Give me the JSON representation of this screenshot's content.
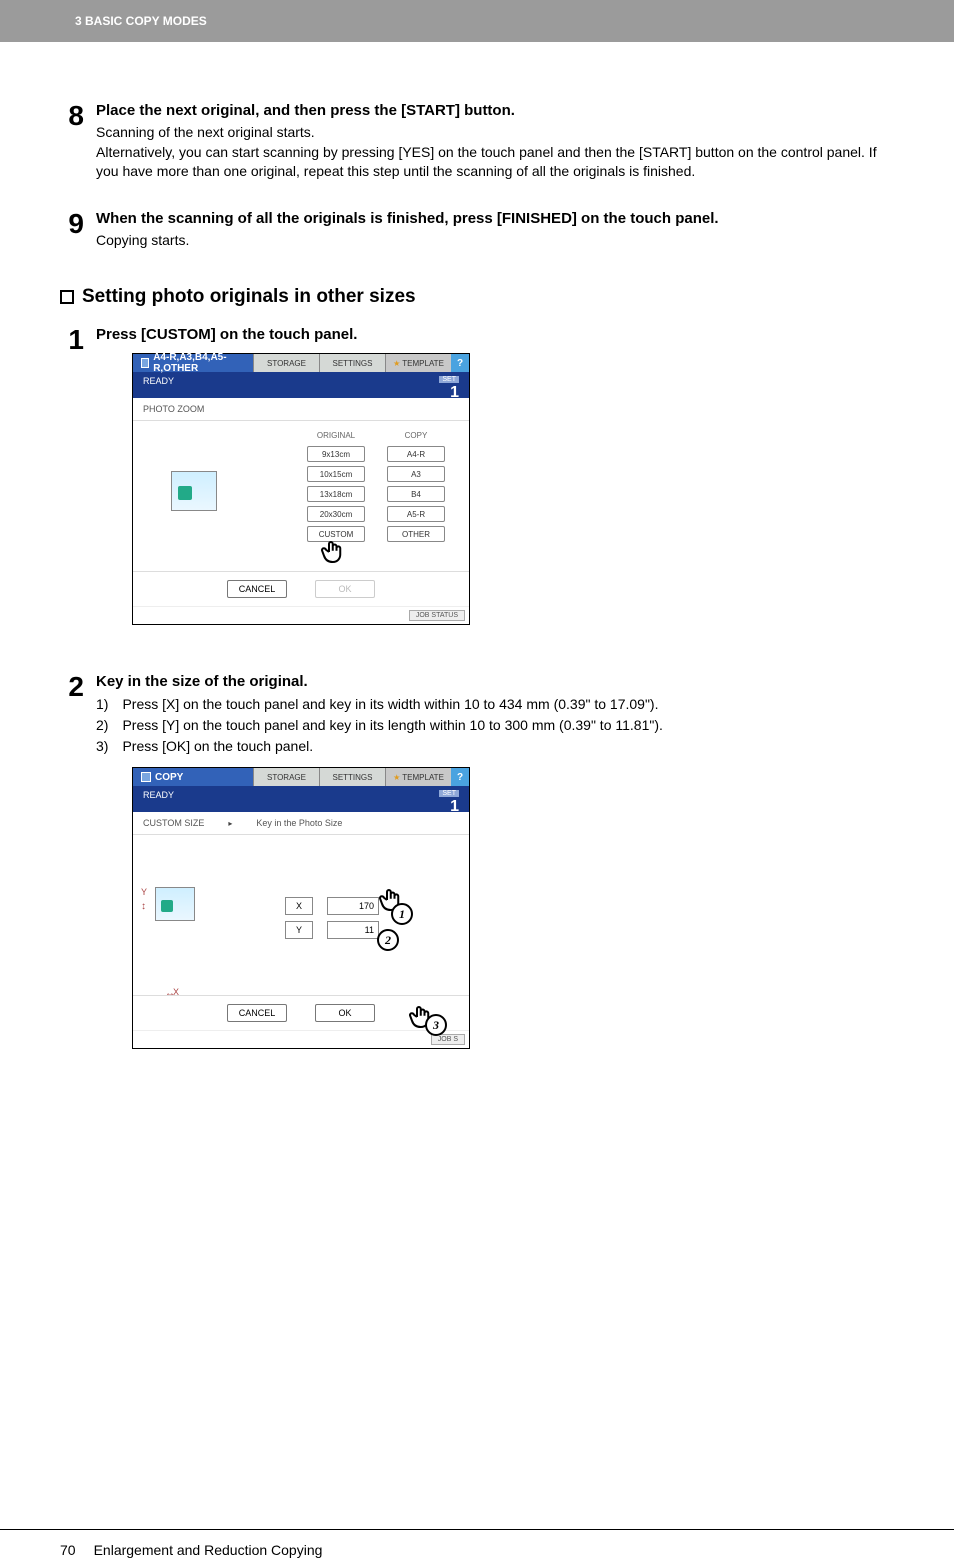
{
  "header": {
    "chapter": "3 BASIC COPY MODES"
  },
  "step8": {
    "num": "8",
    "title": "Place the next original, and then press the [START] button.",
    "line1": "Scanning of the next original starts.",
    "line2": "Alternatively, you can start scanning by pressing [YES] on the touch panel and then the [START] button on the control panel. If you have more than one original, repeat this step until the scanning of all the originals is finished."
  },
  "step9": {
    "num": "9",
    "title": "When the scanning of all the originals is finished, press [FINISHED] on the touch panel.",
    "line1": "Copying starts."
  },
  "section": {
    "title": "Setting photo originals in other sizes"
  },
  "s1": {
    "num": "1",
    "title": "Press [CUSTOM] on the touch panel.",
    "panel": {
      "copy": [
        "A4-R",
        "A3",
        "B4",
        "A5-R",
        "OTHER"
      ],
      "tabs": {
        "storage": "STORAGE",
        "settings": "SETTINGS",
        "template": "TEMPLATE"
      },
      "help": "?",
      "ready": "READY",
      "set": "SET",
      "one": "1",
      "label": "PHOTO ZOOM",
      "col_original": "ORIGINAL",
      "col_copy": "COPY",
      "orig": [
        "9x13cm",
        "10x15cm",
        "13x18cm",
        "20x30cm",
        "CUSTOM"
      ],
      "cancel": "CANCEL",
      "ok": "OK",
      "jobstatus": "JOB STATUS"
    }
  },
  "s2": {
    "num": "2",
    "title": "Key in the size of the original.",
    "l1": "1) Press [X] on the touch panel and key in its width within 10 to 434 mm (0.39\" to 17.09\").",
    "l2": "2) Press [Y] on the touch panel and key in its length within 10 to 300 mm (0.39\" to 11.81\").",
    "l3": "3) Press [OK] on the touch panel.",
    "panel": {
      "copy": "COPY",
      "tabs": {
        "storage": "STORAGE",
        "settings": "SETTINGS",
        "template": "TEMPLATE"
      },
      "help": "?",
      "ready": "READY",
      "set": "SET",
      "one": "1",
      "label1": "CUSTOM SIZE",
      "label2": "Key in the Photo Size",
      "x": "X",
      "y": "Y",
      "xval": "170",
      "yval": "11",
      "cancel": "CANCEL",
      "ok": "OK",
      "jobstatus": "JOB S",
      "call1": "1",
      "call2": "2",
      "call3": "3",
      "axis_y": "Y",
      "axis_x": "X"
    }
  },
  "footer": {
    "page": "70",
    "title": "Enlargement and Reduction Copying"
  }
}
